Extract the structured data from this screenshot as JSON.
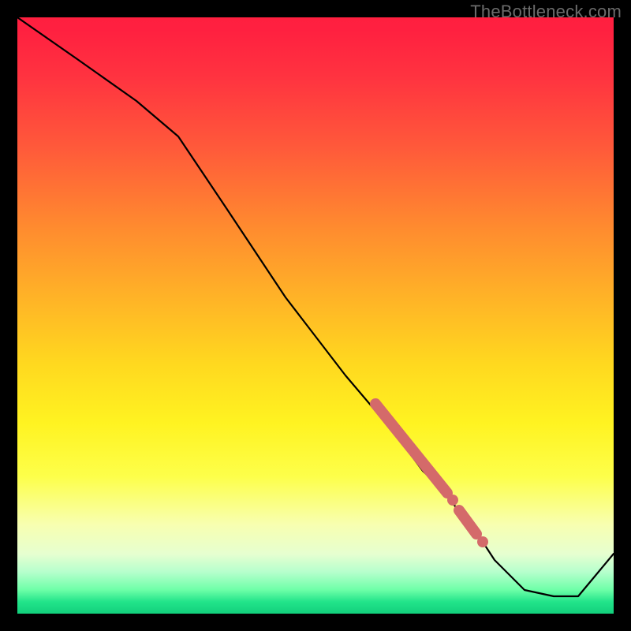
{
  "watermark": "TheBottleneck.com",
  "colors": {
    "highlight": "#d46a6a",
    "curve": "#000000"
  },
  "chart_data": {
    "type": "line",
    "title": "",
    "xlabel": "",
    "ylabel": "",
    "xlim": [
      0,
      100
    ],
    "ylim": [
      0,
      100
    ],
    "grid": false,
    "legend": false,
    "note": "Axes are normalized 0–100; no tick labels or axis titles are visible in the source image. Y values estimated from vertical position within the gradient plot area (top = 100, bottom = 0).",
    "series": [
      {
        "name": "bottleneck-curve",
        "x": [
          0,
          10,
          20,
          27,
          35,
          45,
          55,
          61,
          65,
          68,
          71,
          75,
          78,
          80,
          85,
          90,
          94,
          100
        ],
        "y": [
          100,
          93,
          86,
          80,
          68,
          53,
          40,
          33,
          28,
          24,
          21,
          16,
          12,
          9,
          4,
          3,
          3,
          10
        ]
      }
    ],
    "highlights": {
      "description": "Thick colored band and dots on the descending limb of the curve.",
      "band": {
        "x_start": 60,
        "x_end": 72
      },
      "dots": [
        {
          "x": 73,
          "y": 19
        },
        {
          "x": 78,
          "y": 12
        }
      ],
      "small_bands": [
        {
          "x_start": 74,
          "x_end": 77
        }
      ]
    }
  }
}
